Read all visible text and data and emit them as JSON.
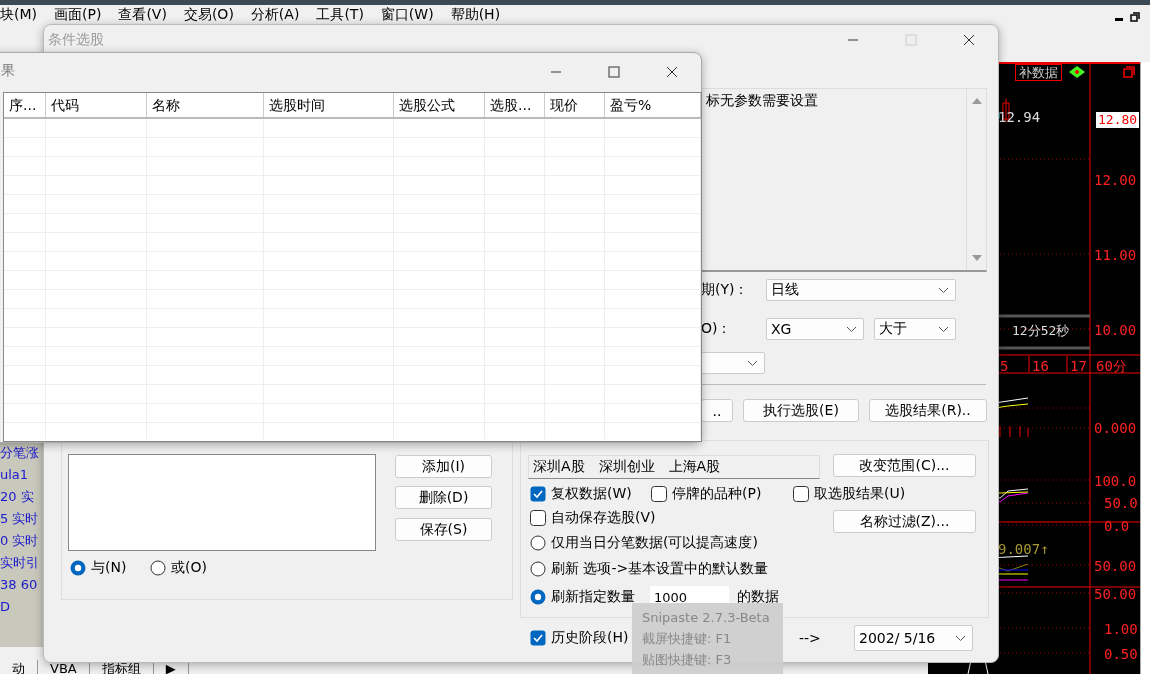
{
  "menu_bar": {
    "items": [
      "块(M)",
      "画面(P)",
      "查看(V)",
      "交易(O)",
      "分析(A)",
      "工具(T)",
      "窗口(W)",
      "帮助(H)"
    ]
  },
  "chart": {
    "toolbar_button": "补数据",
    "high_label": "12.94",
    "current_price": "12.80",
    "price_axis": [
      "12.00",
      "11.00",
      "10.00"
    ],
    "countdown": "12分52秒",
    "time_axis": [
      "5",
      "16",
      "17"
    ],
    "period": "60分",
    "indicator_axis": [
      "0.000",
      "100.0",
      "50.0",
      "0.0",
      "50.00",
      "50.00",
      "1.00",
      "0.50"
    ],
    "indicator_value": "9.007↑"
  },
  "formula_list": {
    "items": [
      "分笔涨",
      "ula1",
      "20 实",
      "5 实时",
      "0 实时",
      "实时引",
      "38 60",
      "D"
    ]
  },
  "bottom_tabs": [
    "动",
    "VBA",
    "指标组",
    "▶"
  ],
  "dialog": {
    "title": "条件选股",
    "description": "标无参数需要设置",
    "period_label": "期(Y)：",
    "period": "日线",
    "condition_label": "O)：",
    "condition_line": "XG",
    "comparison": "大于",
    "buttons": [
      "..",
      "执行选股(E)",
      "选股结果(R).."
    ],
    "condition_buttons": [
      "添加(I)",
      "删除(D)",
      "保存(S)"
    ],
    "logic": [
      {
        "label": "与(N)",
        "selected": true
      },
      {
        "label": "或(O)",
        "selected": false
      }
    ],
    "range": "深圳A股　深圳创业　上海A股",
    "range_buttons": [
      "改变范围(C)...",
      "名称过滤(Z)..."
    ],
    "options": [
      {
        "label": "复权数据(W)",
        "checked": true
      },
      {
        "label": "停牌的品种(P)",
        "checked": false
      },
      {
        "label": "取选股结果(U)",
        "checked": false
      },
      {
        "label": "自动保存选股(V)",
        "checked": false
      }
    ],
    "refresh_modes": [
      {
        "kind": "plain",
        "label": "仅用当日分笔数据(可以提高速度)",
        "selected": false
      },
      {
        "kind": "plain",
        "label": "刷新  选项->基本设置中的默认数量",
        "selected": false
      },
      {
        "kind": "count",
        "label": "刷新指定数量",
        "selected": true,
        "count": "1000",
        "suffix": "的数据"
      }
    ],
    "history": {
      "label": "历史阶段(H)",
      "checked": true,
      "arrow": "-->",
      "to": "2002/ 5/16"
    }
  },
  "results_window": {
    "title": "果",
    "columns": [
      "序...",
      "代码",
      "名称",
      "选股时间",
      "选股公式",
      "选股...",
      "现价",
      "盈亏%"
    ]
  },
  "tooltip": {
    "lines": [
      "Snipaste 2.7.3-Beta",
      "截屏快捷键: F1",
      "贴图快捷键: F3"
    ]
  }
}
